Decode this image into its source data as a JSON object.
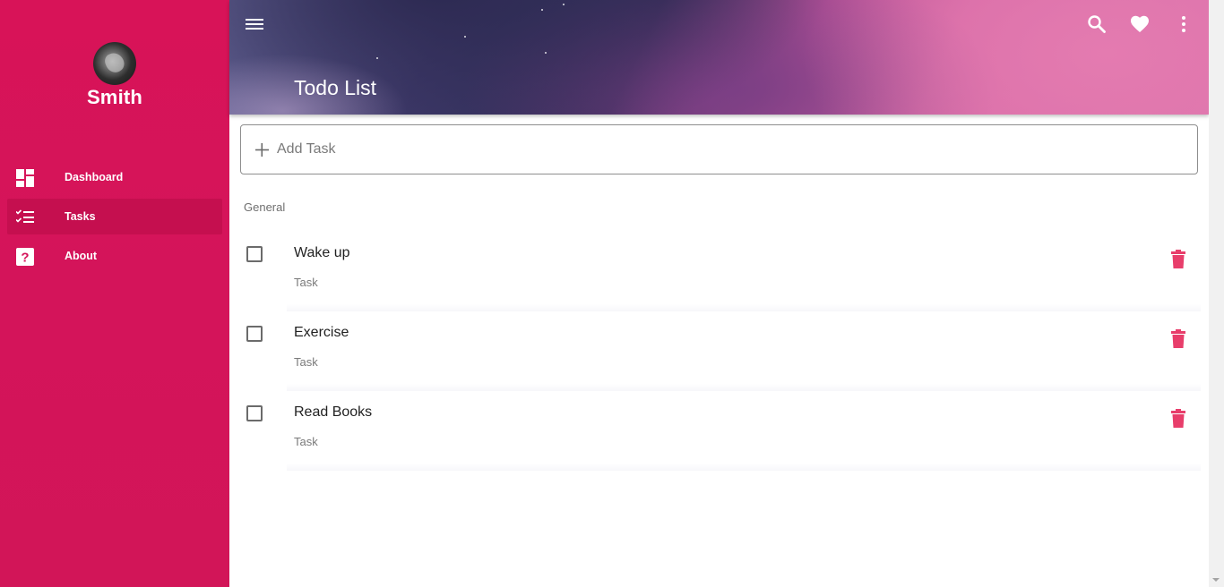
{
  "sidebar": {
    "user_name": "Smith",
    "items": [
      {
        "label": "Dashboard",
        "icon": "dashboard-icon"
      },
      {
        "label": "Tasks",
        "icon": "tasks-icon",
        "active": true
      },
      {
        "label": "About",
        "icon": "help-icon"
      }
    ]
  },
  "header": {
    "title": "Todo List",
    "icons": [
      "menu-icon",
      "search-icon",
      "heart-icon",
      "more-vert-icon"
    ]
  },
  "add_task": {
    "placeholder": "Add Task",
    "value": ""
  },
  "group": {
    "title": "General"
  },
  "tasks": [
    {
      "title": "Wake up",
      "subtitle": "Task",
      "done": false
    },
    {
      "title": "Exercise",
      "subtitle": "Task",
      "done": false
    },
    {
      "title": "Read Books",
      "subtitle": "Task",
      "done": false
    }
  ],
  "colors": {
    "sidebar": "#d4145a",
    "sidebar_active": "#c50f4f",
    "delete_icon": "#e83e6b",
    "header_dark": "#2f2c55",
    "header_pink": "#dc73ac"
  }
}
